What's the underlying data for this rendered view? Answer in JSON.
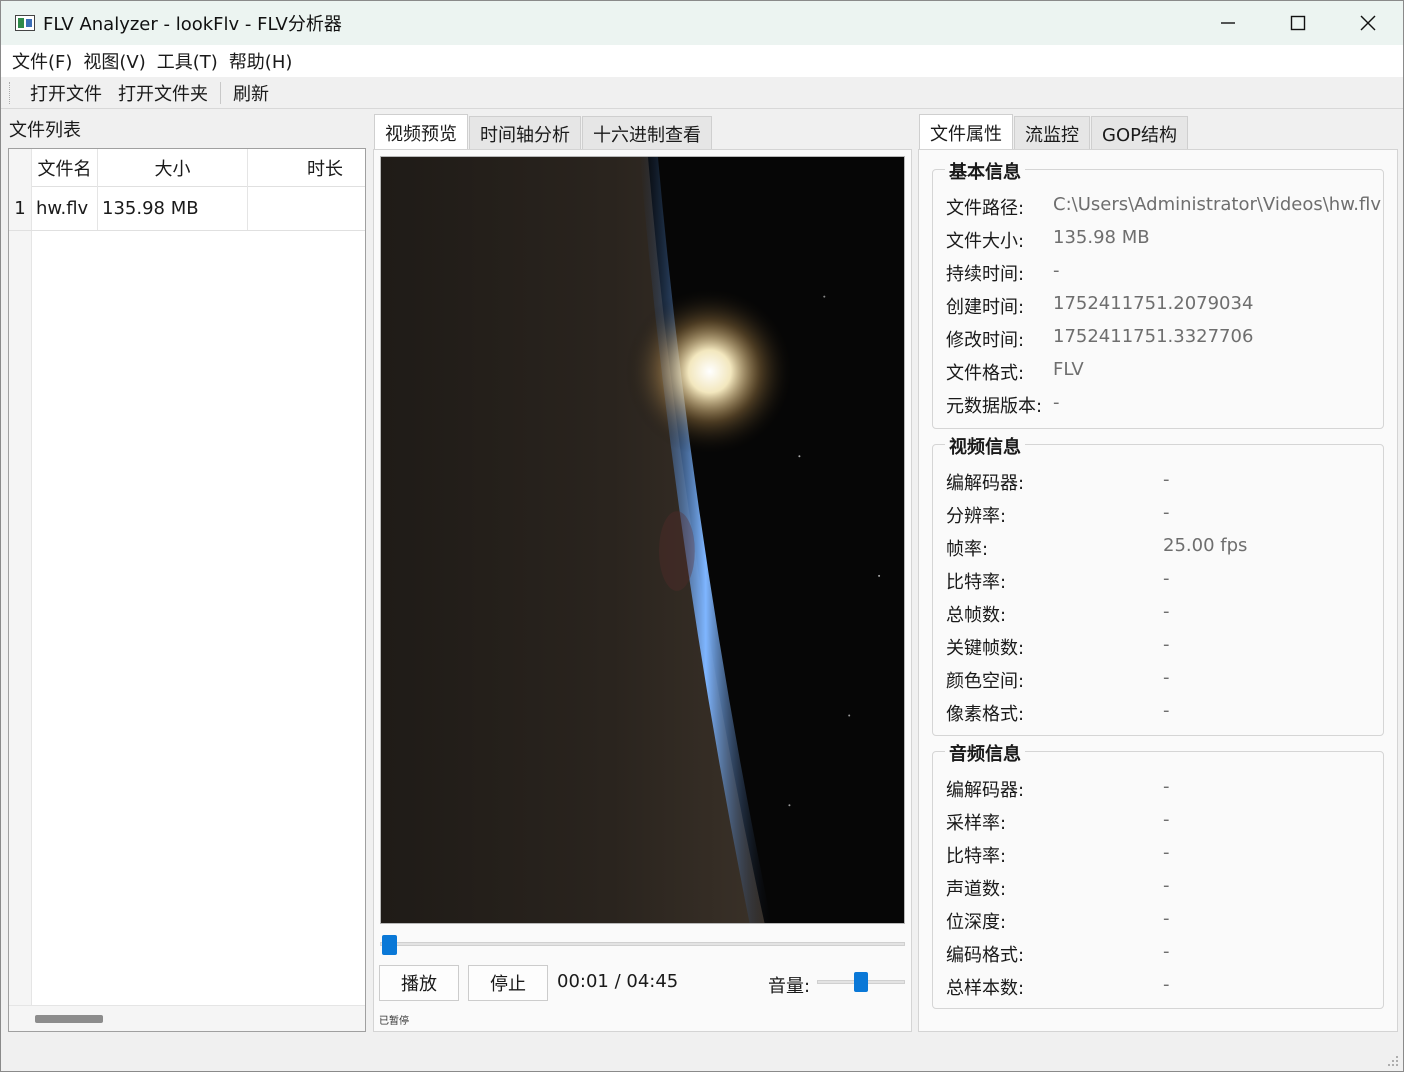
{
  "window": {
    "title": "FLV Analyzer - lookFlv - FLV分析器"
  },
  "menu": [
    "文件(F)",
    "视图(V)",
    "工具(T)",
    "帮助(H)"
  ],
  "toolbar": {
    "open_file": "打开文件",
    "open_folder": "打开文件夹",
    "refresh": "刷新"
  },
  "file_list": {
    "title": "文件列表",
    "columns": [
      "文件名",
      "大小",
      "时长"
    ],
    "rows": [
      {
        "num": "1",
        "name": "hw.flv",
        "size": "135.98 MB",
        "duration": ""
      }
    ]
  },
  "center_tabs": [
    "视频预览",
    "时间轴分析",
    "十六进制查看"
  ],
  "player": {
    "play": "播放",
    "stop": "停止",
    "time": "00:01 / 04:45",
    "volume_label": "音量:",
    "status": "已暂停",
    "progress_fraction": 0.004,
    "volume_fraction": 0.5
  },
  "right_tabs": [
    "文件属性",
    "流监控",
    "GOP结构"
  ],
  "basic_info": {
    "title": "基本信息",
    "rows": [
      {
        "label": "文件路径:",
        "value": "C:\\Users\\Administrator\\Videos\\hw.flv"
      },
      {
        "label": "文件大小:",
        "value": "135.98 MB"
      },
      {
        "label": "持续时间:",
        "value": "-"
      },
      {
        "label": "创建时间:",
        "value": "1752411751.2079034"
      },
      {
        "label": "修改时间:",
        "value": "1752411751.3327706"
      },
      {
        "label": "文件格式:",
        "value": "FLV"
      },
      {
        "label": "元数据版本:",
        "value": "-"
      }
    ]
  },
  "video_info": {
    "title": "视频信息",
    "rows": [
      {
        "label": "编解码器:",
        "value": "-"
      },
      {
        "label": "分辨率:",
        "value": "-"
      },
      {
        "label": "帧率:",
        "value": "25.00 fps"
      },
      {
        "label": "比特率:",
        "value": "-"
      },
      {
        "label": "总帧数:",
        "value": "-"
      },
      {
        "label": "关键帧数:",
        "value": "-"
      },
      {
        "label": "颜色空间:",
        "value": "-"
      },
      {
        "label": "像素格式:",
        "value": "-"
      }
    ]
  },
  "audio_info": {
    "title": "音频信息",
    "rows": [
      {
        "label": "编解码器:",
        "value": "-"
      },
      {
        "label": "采样率:",
        "value": "-"
      },
      {
        "label": "比特率:",
        "value": "-"
      },
      {
        "label": "声道数:",
        "value": "-"
      },
      {
        "label": "位深度:",
        "value": "-"
      },
      {
        "label": "编码格式:",
        "value": "-"
      },
      {
        "label": "总样本数:",
        "value": "-"
      }
    ]
  },
  "colors": {
    "accent": "#0a78d7",
    "titlebar_bg": "#ecf4f1"
  }
}
